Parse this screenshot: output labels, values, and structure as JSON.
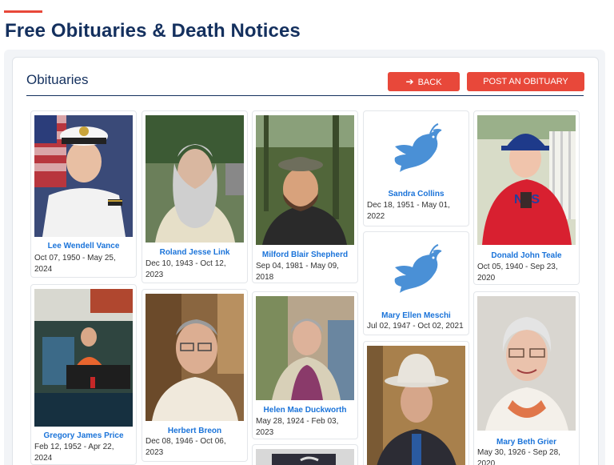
{
  "page": {
    "title": "Free Obituaries & Death Notices"
  },
  "section": {
    "title": "Obituaries"
  },
  "buttons": {
    "back": "BACK",
    "post": "POST AN OBITUARY"
  },
  "colors": {
    "accent": "#e8483a",
    "navy": "#14305e",
    "link_blue": "#1a73d9",
    "dove_blue": "#4a90d6"
  },
  "obituaries": [
    {
      "name": "Lee Wendell Vance",
      "dates": "Oct 07, 1950 - May 25, 2024"
    },
    {
      "name": "Roland Jesse Link",
      "dates": "Dec 10, 1943 - Oct 12, 2023"
    },
    {
      "name": "Milford Blair Shepherd",
      "dates": "Sep 04, 1981 - May 09, 2018"
    },
    {
      "name": "Sandra Collins",
      "dates": "Dec 18, 1951 - May 01, 2022",
      "icon": "dove-icon"
    },
    {
      "name": "Donald John Teale",
      "dates": "Oct 05, 1940 - Sep 23, 2020"
    },
    {
      "name": "Gregory James Price",
      "dates": "Feb 12, 1952 - Apr 22, 2024"
    },
    {
      "name": "Herbert Breon",
      "dates": "Dec 08, 1946 - Oct 06, 2023"
    },
    {
      "name": "Helen Mae Duckworth",
      "dates": "May 28, 1924 - Feb 03, 2023"
    },
    {
      "name": "Mary Ellen Meschi",
      "dates": "Jul 02, 1947 - Oct 02, 2021",
      "icon": "dove-icon"
    },
    {
      "name": "Mary Beth Grier",
      "dates": "May 30, 1926 - Sep 28, 2020"
    }
  ]
}
